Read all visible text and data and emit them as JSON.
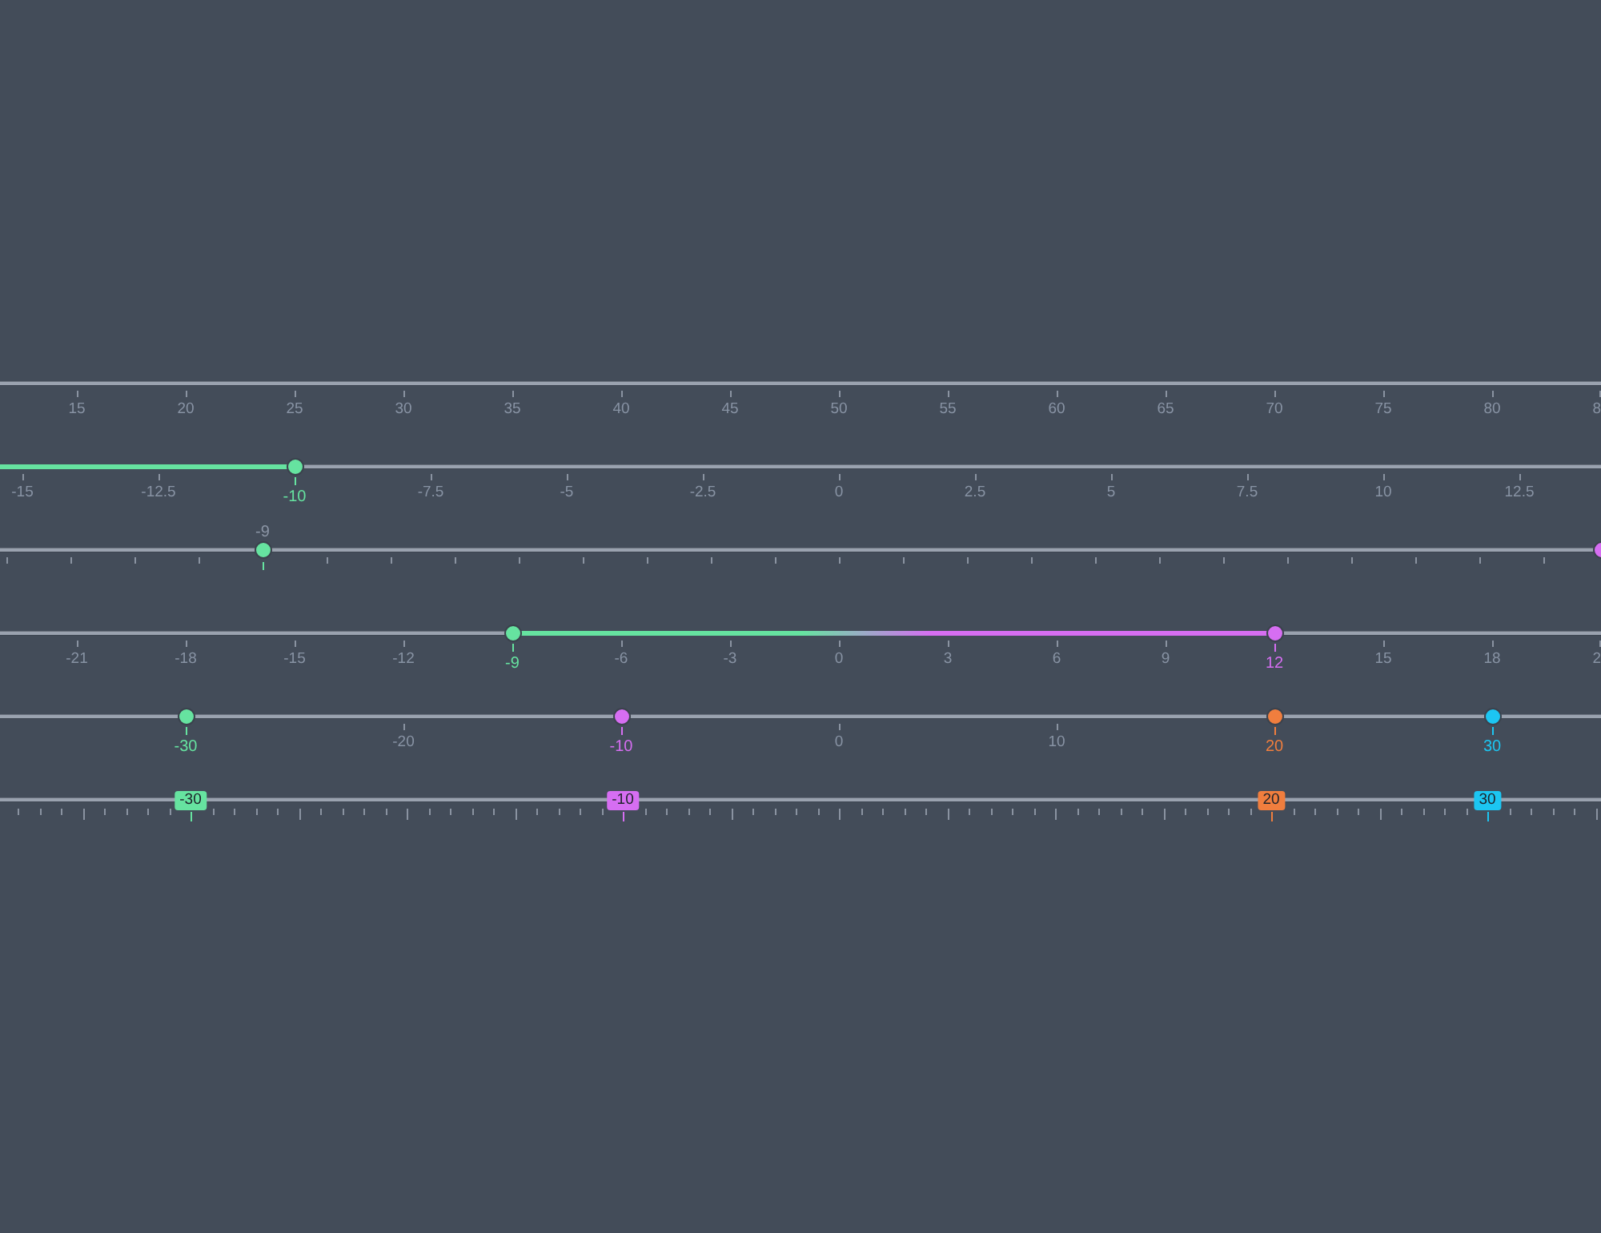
{
  "sliders": [
    {
      "kind": "plain",
      "ticks": [
        "15",
        "20",
        "25",
        "30",
        "35",
        "40",
        "45",
        "50",
        "55",
        "60",
        "65",
        "70",
        "75",
        "80",
        "8"
      ]
    },
    {
      "kind": "fill",
      "thumbs": [
        {
          "value": "-10",
          "level": 0.184,
          "color": "#66e3a0"
        }
      ],
      "ticks": [
        "-15",
        "-12.5",
        "-7.5",
        "-5",
        "-2.5",
        "0",
        "2.5",
        "5",
        "7.5",
        "10",
        "12.5"
      ]
    },
    {
      "kind": "label-above",
      "thumbs": [
        {
          "value": "-9",
          "level": 0.164,
          "color": "#66e3a0"
        },
        {
          "level": 1,
          "color": "#d66ef2"
        }
      ]
    },
    {
      "kind": "range",
      "thumbs": [
        {
          "value": "-9",
          "level": 0.32,
          "color": "#66e3a0"
        },
        {
          "value": "12",
          "level": 0.796,
          "color": "#d66ef2"
        }
      ],
      "ticks": [
        "-21",
        "-18",
        "-15",
        "-12",
        "-6",
        "-3",
        "0",
        "3",
        "6",
        "9",
        "15",
        "18",
        "2"
      ]
    },
    {
      "kind": "multi",
      "thumbs": [
        {
          "value": "-30",
          "level": 0.116,
          "color": "#66e3a0"
        },
        {
          "value": "-10",
          "level": 0.388,
          "color": "#d66ef2"
        },
        {
          "value": "20",
          "level": 0.796,
          "color": "#f07e3e"
        },
        {
          "value": "30",
          "level": 0.932,
          "color": "#1cc6f2"
        }
      ],
      "ticks": [
        "-20",
        "0",
        "10"
      ]
    },
    {
      "kind": "badges",
      "thumbs": [
        {
          "value": "-30",
          "level": 0.119,
          "color": "#66e3a0"
        },
        {
          "value": "-10",
          "level": 0.389,
          "color": "#d66ef2"
        },
        {
          "value": "20",
          "level": 0.794,
          "color": "#f07e3e"
        },
        {
          "value": "30",
          "level": 0.929,
          "color": "#1cc6f2"
        }
      ]
    }
  ]
}
